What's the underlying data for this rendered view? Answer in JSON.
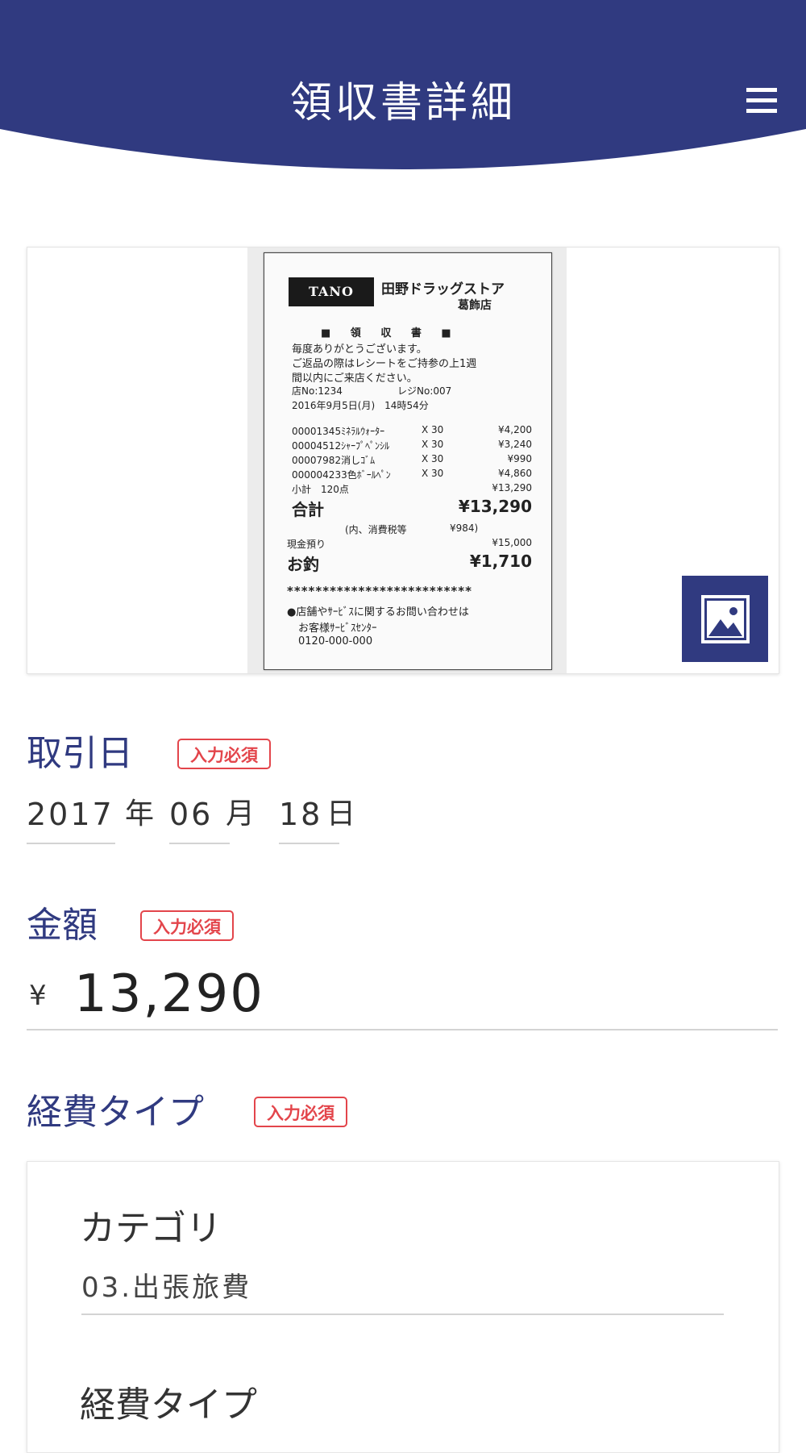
{
  "header": {
    "title": "領収書詳細",
    "menu_icon": "hamburger-menu-icon",
    "color": "#303a80"
  },
  "receipt_image": {
    "logo": "TANO",
    "store_name": "田野ドラッグストア",
    "branch": "葛飾店",
    "heading": "■ 領 収 書 ■",
    "greeting_1": "毎度ありがとうございます。",
    "greeting_2": "ご返品の際はレシートをご持参の上1週",
    "greeting_3": "間以内にご来店ください。",
    "store_no": "店No:1234",
    "register_no": "レジNo:007",
    "datetime": "2016年9月5日(月)　14時54分",
    "items": [
      {
        "name": "00001345ﾐﾈﾗﾙｳｫｰﾀｰ",
        "qty": "X 30",
        "price": "¥4,200"
      },
      {
        "name": "00004512ｼｬｰﾌﾟﾍﾟﾝｼﾙ",
        "qty": "X 30",
        "price": "¥3,240"
      },
      {
        "name": "00007982消しｺﾞﾑ",
        "qty": "X 30",
        "price": "¥990"
      },
      {
        "name": "000004233色ﾎﾞｰﾙﾍﾟﾝ",
        "qty": "X 30",
        "price": "¥4,860"
      }
    ],
    "subtotal_label": "小計　120点",
    "subtotal_value": "¥13,290",
    "total_label": "合計",
    "total_value": "¥13,290",
    "tax_label": "(内、消費税等",
    "tax_value": "¥984)",
    "cash_label": "現金預り",
    "cash_value": "¥15,000",
    "change_label": "お釣",
    "change_value": "¥1,710",
    "stars": "**************************",
    "inquiry_1": "●店舗やｻｰﾋﾞｽに関するお問い合わせは",
    "inquiry_2": "お客様ｻｰﾋﾞｽｾﾝﾀｰ",
    "phone": "0120-000-000",
    "button_icon": "image-icon"
  },
  "transaction_date": {
    "label": "取引日",
    "required": "入力必須",
    "year": "2017",
    "year_unit": "年",
    "month": "06",
    "month_unit": "月",
    "day": "18",
    "day_unit": "日"
  },
  "amount": {
    "label": "金額",
    "required": "入力必須",
    "currency": "¥",
    "value": "13,290"
  },
  "expense_type": {
    "label": "経費タイプ",
    "required": "入力必須",
    "category_label": "カテゴリ",
    "category_value": "03.出張旅費",
    "type_label": "経費タイプ"
  }
}
